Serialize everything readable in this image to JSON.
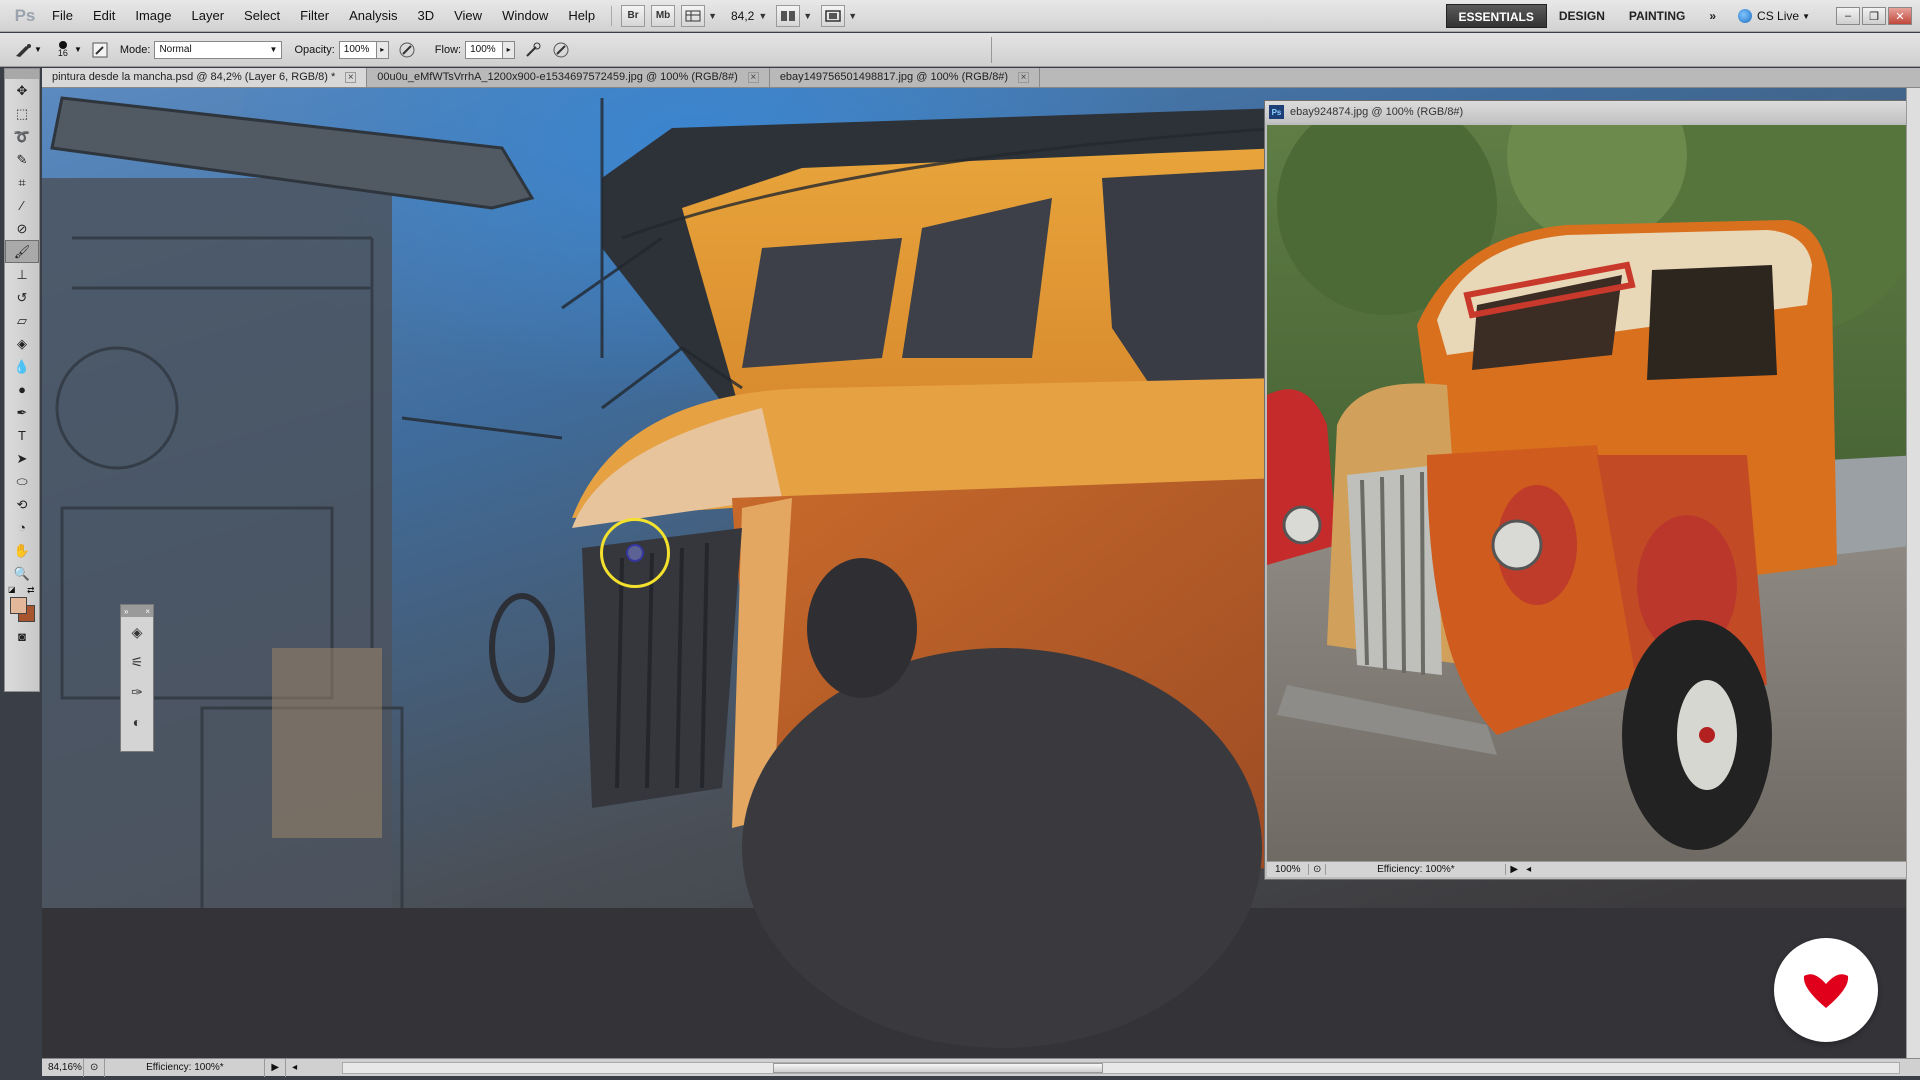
{
  "app": {
    "logo": "Ps",
    "menu": [
      "File",
      "Edit",
      "Image",
      "Layer",
      "Select",
      "Filter",
      "Analysis",
      "3D",
      "View",
      "Window",
      "Help"
    ],
    "bridge_btn": "Br",
    "minibridge_btn": "Mb",
    "zoom": "84,2",
    "workspaces": {
      "essentials": "ESSENTIALS",
      "design": "DESIGN",
      "painting": "PAINTING",
      "more": "»"
    },
    "cslive": "CS Live"
  },
  "options": {
    "brush_size": "16",
    "mode_label": "Mode:",
    "mode_value": "Normal",
    "opacity_label": "Opacity:",
    "opacity_value": "100%",
    "flow_label": "Flow:",
    "flow_value": "100%"
  },
  "tabs": [
    {
      "label": "pintura desde la mancha.psd @ 84,2% (Layer 6, RGB/8) *",
      "active": true
    },
    {
      "label": "00u0u_eMfWTsVrrhA_1200x900-e1534697572459.jpg @ 100% (RGB/8#)",
      "active": false
    },
    {
      "label": "ebay149756501498817.jpg @ 100% (RGB/8#)",
      "active": false
    }
  ],
  "reference": {
    "title": "ebay924874.jpg @ 100% (RGB/8#)",
    "zoom": "100%",
    "efficiency": "Efficiency: 100%*"
  },
  "status": {
    "zoom": "84,16%",
    "efficiency": "Efficiency: 100%*"
  },
  "colors": {
    "foreground": "#e2b79a",
    "background": "#a8552f",
    "cursor_ring": "#f3e12e",
    "brand": "#e0001b"
  }
}
